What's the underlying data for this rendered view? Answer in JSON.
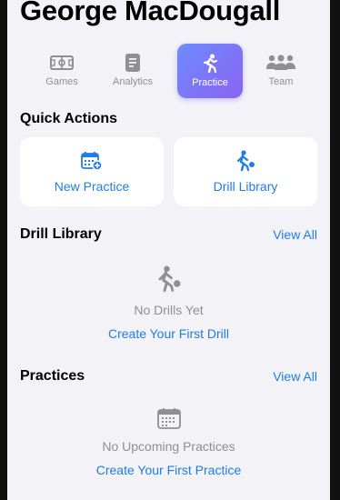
{
  "header": {
    "title": "George MacDougall"
  },
  "tabs": [
    {
      "label": "Games",
      "icon": "soccer-field-icon"
    },
    {
      "label": "Analytics",
      "icon": "document-icon"
    },
    {
      "label": "Practice",
      "icon": "running-figure-icon"
    },
    {
      "label": "Team",
      "icon": "people-group-icon"
    }
  ],
  "quick_actions": {
    "title": "Quick Actions",
    "new_practice": "New Practice",
    "drill_library": "Drill Library"
  },
  "drill_library": {
    "title": "Drill Library",
    "view_all": "View All",
    "empty_message": "No Drills Yet",
    "create_link": "Create Your First Drill"
  },
  "practices": {
    "title": "Practices",
    "view_all": "View All",
    "empty_message": "No Upcoming Practices",
    "create_link": "Create Your First Practice"
  },
  "colors": {
    "accent": "#1f7de5",
    "tab_active_start": "#6f8bff",
    "tab_active_end": "#8a63f0"
  }
}
